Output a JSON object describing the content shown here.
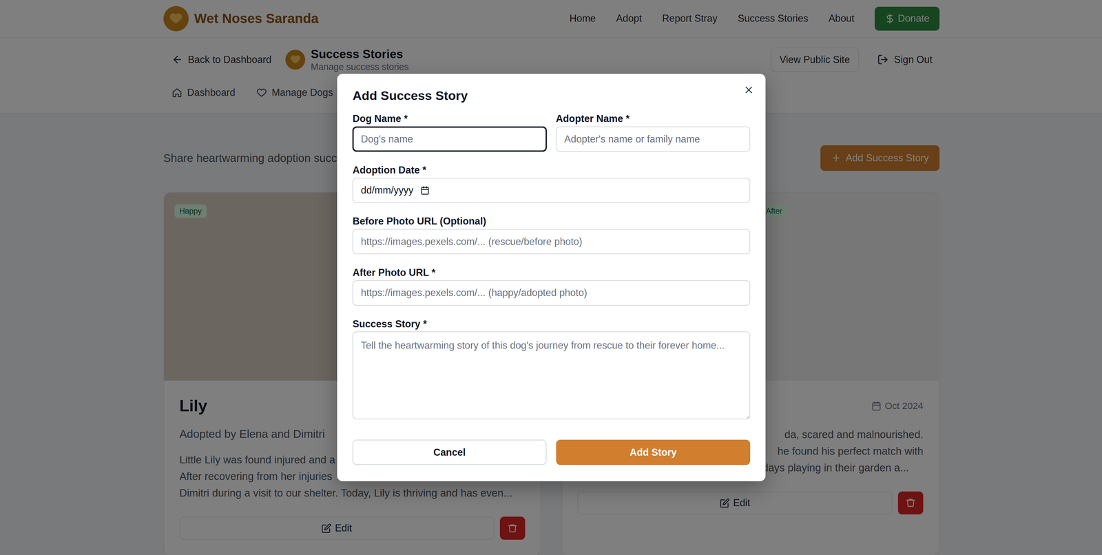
{
  "header": {
    "brand": "Wet Noses Saranda",
    "nav": [
      {
        "label": "Home"
      },
      {
        "label": "Adopt"
      },
      {
        "label": "Report Stray"
      },
      {
        "label": "Success Stories"
      },
      {
        "label": "About"
      }
    ],
    "donate": "Donate"
  },
  "admin": {
    "back": "Back to Dashboard",
    "title": "Success Stories",
    "subtitle": "Manage success stories",
    "view_public": "View Public Site",
    "sign_out": "Sign Out",
    "tabs": [
      {
        "label": "Dashboard",
        "selected": false
      },
      {
        "label": "Manage Dogs",
        "selected": false
      }
    ]
  },
  "page": {
    "intro": "Share heartwarming adoption succe",
    "add_button": "Add Success Story"
  },
  "stories": [
    {
      "photos": [
        {
          "badge": "Happy"
        }
      ],
      "name": "Lily",
      "adopter": "Adopted by Elena and Dimitri",
      "lines": [
        {
          "text": "Little Lily was found injured and a",
          "kind": "tail-hidden"
        },
        {
          "text": "After recovering from her injuries",
          "kind": "tail-hidden"
        },
        {
          "text": "Dimitri during a visit to our shelter. Today, Lily is thriving and has even...",
          "kind": "whole"
        }
      ],
      "edit": "Edit"
    },
    {
      "photos": [
        {},
        {
          "badge": "After"
        }
      ],
      "date": "Oct 2024",
      "lines": [
        {
          "text": "da, scared and malnourished.",
          "kind": "head-hidden"
        },
        {
          "text": "he found his perfect match with",
          "kind": "head-hidden"
        },
        {
          "text": "the Johnson family. Now he spends his days playing in their garden a...",
          "kind": "whole"
        }
      ],
      "edit": "Edit"
    }
  ],
  "modal": {
    "title": "Add Success Story",
    "rows": [
      [
        {
          "label": "Dog Name *",
          "placeholder": "Dog's name",
          "kind": "text",
          "focused": true
        },
        {
          "label": "Adopter Name *",
          "placeholder": "Adopter's name or family name",
          "kind": "text",
          "focused": false
        }
      ],
      [
        {
          "label": "Adoption Date *",
          "placeholder": "dd/mm/yyyy",
          "kind": "date",
          "focused": false
        }
      ],
      [
        {
          "label": "Before Photo URL (Optional)",
          "placeholder": "https://images.pexels.com/... (rescue/before photo)",
          "kind": "text",
          "focused": false
        }
      ],
      [
        {
          "label": "After Photo URL *",
          "placeholder": "https://images.pexels.com/... (happy/adopted photo)",
          "kind": "text",
          "focused": false
        }
      ],
      [
        {
          "label": "Success Story *",
          "placeholder": "Tell the heartwarming story of this dog's journey from rescue to their forever home...",
          "kind": "textarea",
          "focused": false
        }
      ]
    ],
    "buttons": [
      {
        "label": "Cancel",
        "kind": "secondary"
      },
      {
        "label": "Add Story",
        "kind": "primary"
      }
    ]
  }
}
